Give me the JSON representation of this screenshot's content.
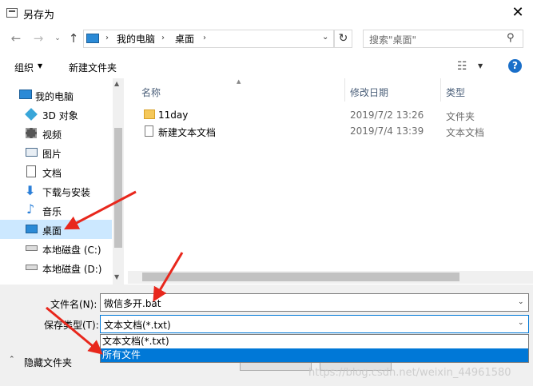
{
  "window": {
    "title": "另存为"
  },
  "navbar": {
    "breadcrumb": [
      "我的电脑",
      "桌面"
    ],
    "search_placeholder": "搜索\"桌面\""
  },
  "toolbar": {
    "organize": "组织",
    "new_folder": "新建文件夹"
  },
  "sidebar": {
    "items": [
      {
        "label": "我的电脑",
        "icon": "computer-icon"
      },
      {
        "label": "3D 对象",
        "icon": "cube-icon"
      },
      {
        "label": "视频",
        "icon": "video-icon"
      },
      {
        "label": "图片",
        "icon": "picture-icon"
      },
      {
        "label": "文档",
        "icon": "document-icon"
      },
      {
        "label": "下载与安装",
        "icon": "download-icon"
      },
      {
        "label": "音乐",
        "icon": "music-icon"
      },
      {
        "label": "桌面",
        "icon": "desktop-icon",
        "selected": true
      },
      {
        "label": "本地磁盘 (C:)",
        "icon": "drive-icon"
      },
      {
        "label": "本地磁盘 (D:)",
        "icon": "drive-icon"
      }
    ]
  },
  "filelist": {
    "columns": [
      "名称",
      "修改日期",
      "类型"
    ],
    "rows": [
      {
        "name": "11day",
        "date": "2019/7/2 13:26",
        "type": "文件夹",
        "icon": "folder-icon"
      },
      {
        "name": "新建文本文档",
        "date": "2019/7/4 13:39",
        "type": "文本文档",
        "icon": "text-file-icon"
      }
    ]
  },
  "form": {
    "filename_label": "文件名(N):",
    "filename_value": "微信多开.bat",
    "filetype_label": "保存类型(T):",
    "filetype_value": "文本文档(*.txt)",
    "filetype_options": [
      "文本文档(*.txt)",
      "所有文件"
    ],
    "hide_folders": "隐藏文件夹"
  },
  "watermark": "https://blog.csdn.net/weixin_44961580",
  "colors": {
    "selection": "#cce8ff",
    "accent": "#0078d7",
    "annotation": "#e8271c"
  }
}
